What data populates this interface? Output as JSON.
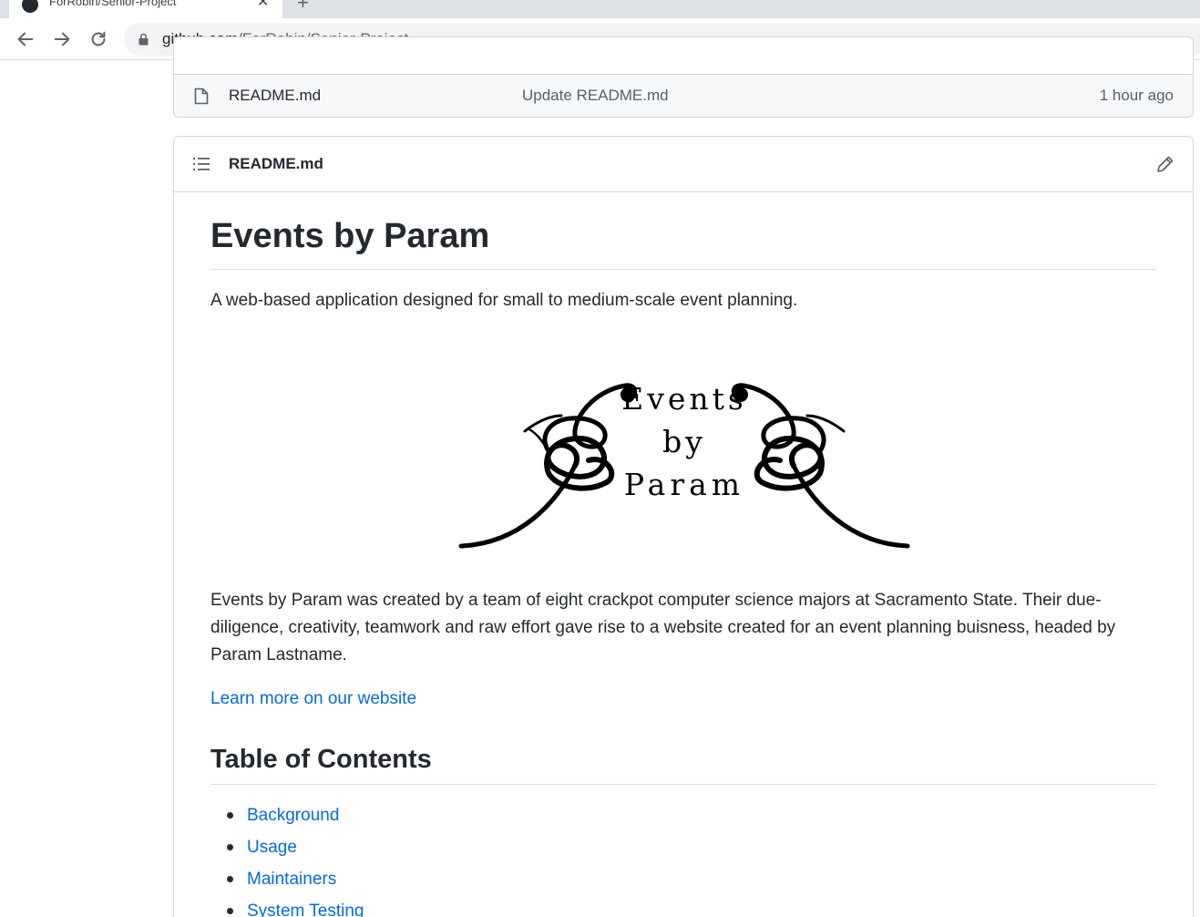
{
  "browser": {
    "tab_title": "ForRobin/Senior-Project",
    "tab_close": "✕",
    "new_tab": "+",
    "url_host": "github.com",
    "url_path": "/ForRobin/Senior-Project"
  },
  "files": {
    "rows": [
      {
        "name": "README.md",
        "commit_message": "Update README.md",
        "age": "1 hour ago"
      }
    ]
  },
  "readme": {
    "header_title": "README.md",
    "h1": "Events by Param",
    "intro": "A web-based application designed for small to medium-scale event planning.",
    "logo": {
      "line1": "Events",
      "line2": "by",
      "line3": "Param"
    },
    "description": "Events by Param was created by a team of eight crackpot computer science majors at Sacramento State. Their due-diligence, creativity, teamwork and raw effort gave rise to a website created for an event planning buisness, headed by Param Lastname.",
    "learn_more_link": "Learn more on our website",
    "toc_heading": "Table of Contents",
    "toc_items": [
      "Background",
      "Usage",
      "Maintainers",
      "System Testing"
    ]
  }
}
